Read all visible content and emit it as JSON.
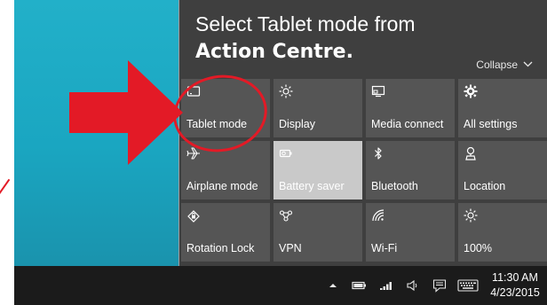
{
  "instruction": {
    "line1": "Select Tablet mode from",
    "line2": "Action Centre."
  },
  "action_center": {
    "collapse_label": "Collapse",
    "tiles": [
      {
        "label": "Tablet mode",
        "icon": "tablet-icon",
        "state": "off"
      },
      {
        "label": "Display",
        "icon": "brightness-icon",
        "state": "off"
      },
      {
        "label": "Media connect",
        "icon": "cast-icon",
        "state": "off"
      },
      {
        "label": "All settings",
        "icon": "gear-icon",
        "state": "off"
      },
      {
        "label": "Airplane mode",
        "icon": "airplane-icon",
        "state": "off"
      },
      {
        "label": "Battery saver",
        "icon": "battery-icon",
        "state": "on"
      },
      {
        "label": "Bluetooth",
        "icon": "bluetooth-icon",
        "state": "off"
      },
      {
        "label": "Location",
        "icon": "location-icon",
        "state": "off"
      },
      {
        "label": "Rotation Lock",
        "icon": "rotation-lock-icon",
        "state": "off"
      },
      {
        "label": "VPN",
        "icon": "vpn-icon",
        "state": "off"
      },
      {
        "label": "Wi-Fi",
        "icon": "wifi-icon",
        "state": "off"
      },
      {
        "label": "100%",
        "icon": "brightness-icon",
        "state": "off"
      }
    ]
  },
  "taskbar": {
    "time": "11:30 AM",
    "date": "4/23/2015",
    "tray_icons": [
      "chevron-up-icon",
      "battery-icon",
      "signal-icon",
      "volume-icon",
      "notification-icon",
      "keyboard-icon"
    ]
  },
  "colors": {
    "panel_bg": "#3f3f3f",
    "tile_bg": "#555555",
    "tile_active_bg": "#c9c9c9",
    "annotation_red": "#e31a26",
    "desktop_teal": "#1aa6c1",
    "taskbar_bg": "#1b1b1b"
  }
}
